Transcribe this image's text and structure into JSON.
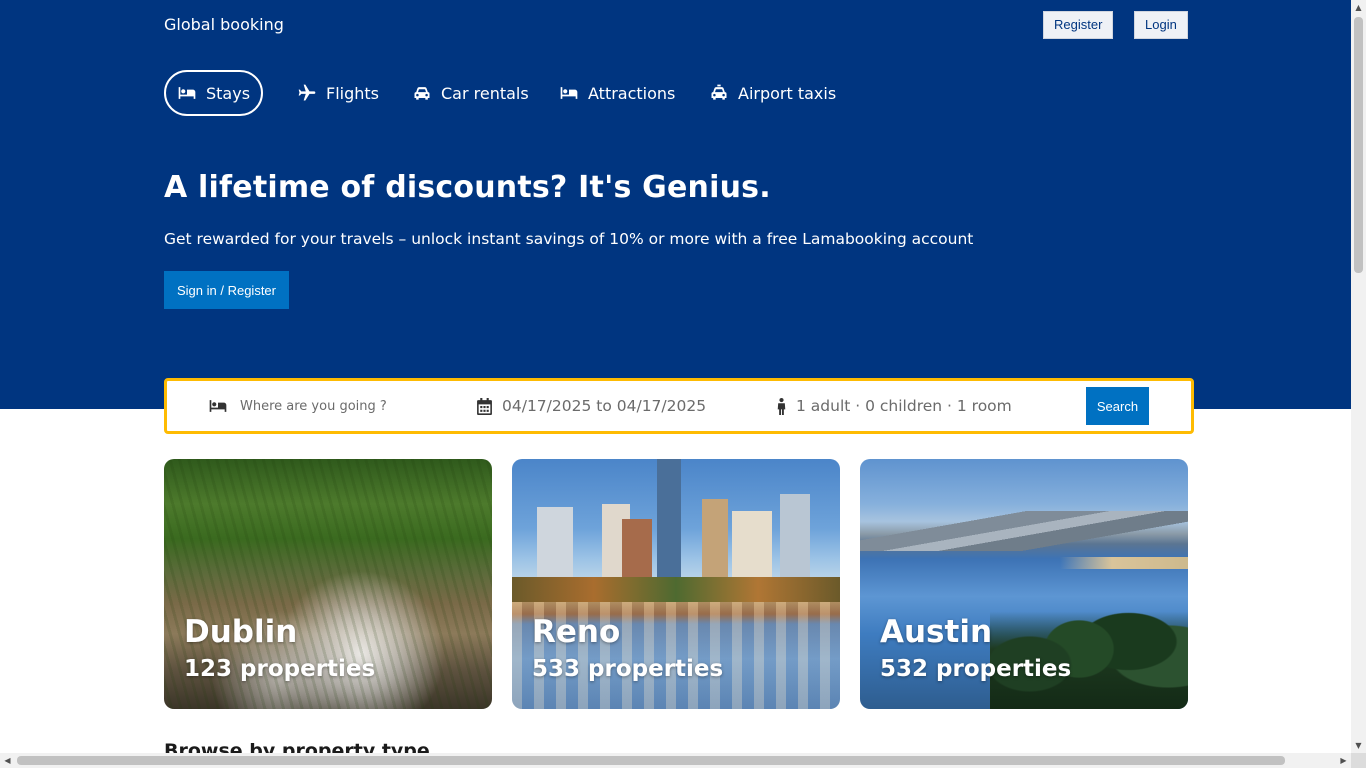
{
  "navbar": {
    "logo": "Global booking",
    "register_label": "Register",
    "login_label": "Login"
  },
  "tabs": [
    {
      "label": "Stays",
      "icon": "bed-icon",
      "active": true
    },
    {
      "label": "Flights",
      "icon": "plane-icon",
      "active": false
    },
    {
      "label": "Car rentals",
      "icon": "car-icon",
      "active": false
    },
    {
      "label": "Attractions",
      "icon": "bed-icon",
      "active": false
    },
    {
      "label": "Airport taxis",
      "icon": "taxi-icon",
      "active": false
    }
  ],
  "hero": {
    "title": "A lifetime of discounts? It's Genius.",
    "subtitle": "Get rewarded for your travels – unlock instant savings of 10% or more with a free Lamabooking account",
    "button_label": "Sign in / Register"
  },
  "search": {
    "destination_placeholder": "Where are you going ?",
    "destination_value": "",
    "dates": "04/17/2025 to 04/17/2025",
    "guests": "1 adult · 0 children · 1 room",
    "button_label": "Search"
  },
  "featured": [
    {
      "city": "Dublin",
      "properties": "123 properties"
    },
    {
      "city": "Reno",
      "properties": "533 properties"
    },
    {
      "city": "Austin",
      "properties": "532 properties"
    }
  ],
  "sections": {
    "browse_title": "Browse by property type"
  },
  "colors": {
    "header_bg": "#003580",
    "primary_button": "#0071c2",
    "search_border": "#febb02"
  }
}
